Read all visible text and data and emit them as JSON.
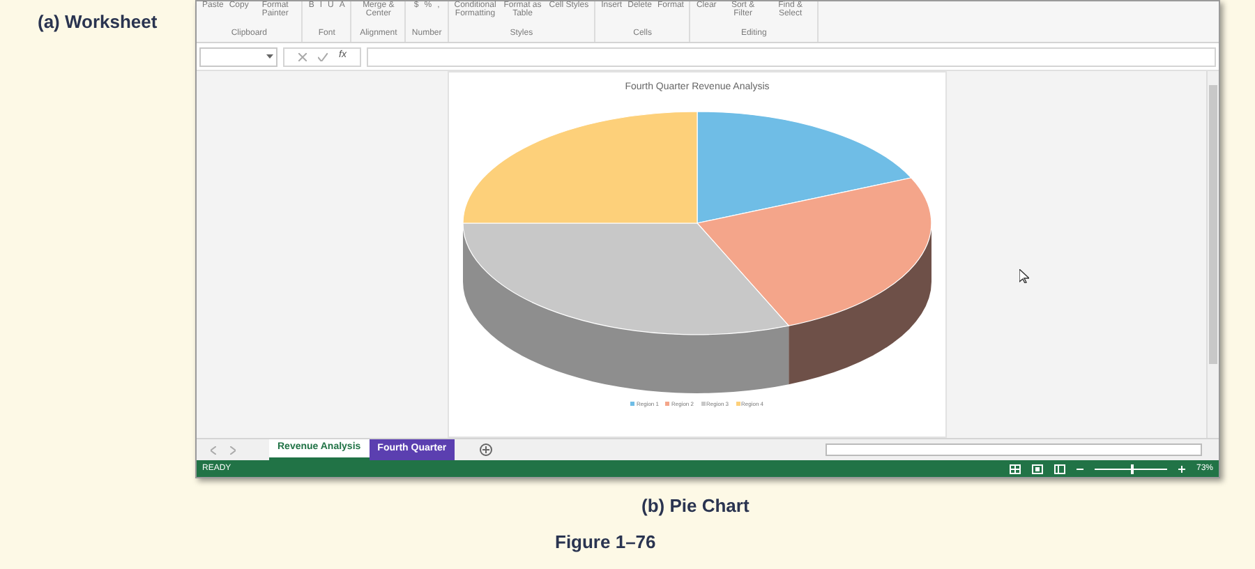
{
  "figure_labels": {
    "top": "(a) Worksheet",
    "caption": "(b) Pie Chart",
    "figure": "Figure 1–76"
  },
  "ribbon": {
    "groups": [
      {
        "label": "Clipboard",
        "items": [
          "Paste",
          "Copy",
          "Format Painter"
        ]
      },
      {
        "label": "Font",
        "items": [
          "B",
          "I",
          "U",
          "A"
        ]
      },
      {
        "label": "Alignment",
        "items": [
          "Merge & Center"
        ]
      },
      {
        "label": "Number",
        "items": [
          "$",
          "%",
          ","
        ]
      },
      {
        "label": "Styles",
        "items": [
          "Conditional Formatting",
          "Format as Table",
          "Cell Styles"
        ]
      },
      {
        "label": "Cells",
        "items": [
          "Insert",
          "Delete",
          "Format"
        ]
      },
      {
        "label": "Editing",
        "items": [
          "Clear",
          "Sort & Filter",
          "Find & Select"
        ]
      }
    ]
  },
  "formula_bar": {
    "fx": "fx"
  },
  "chart": {
    "title": "Fourth Quarter Revenue Analysis",
    "legend": [
      {
        "label": "Region 1",
        "color": "#6fbde6"
      },
      {
        "label": "Region 2",
        "color": "#f4a58a"
      },
      {
        "label": "Region 3",
        "color": "#c8c8c8"
      },
      {
        "label": "Region 4",
        "color": "#fdd07a"
      }
    ]
  },
  "sheet_tabs": [
    {
      "label": "Revenue Analysis",
      "selected": true
    },
    {
      "label": "Fourth Quarter",
      "selected": false,
      "color": "#5b3fb0"
    }
  ],
  "status_bar": {
    "mode": "READY",
    "zoom": "73%",
    "zoom_slider": {
      "level": 0.5
    }
  }
}
